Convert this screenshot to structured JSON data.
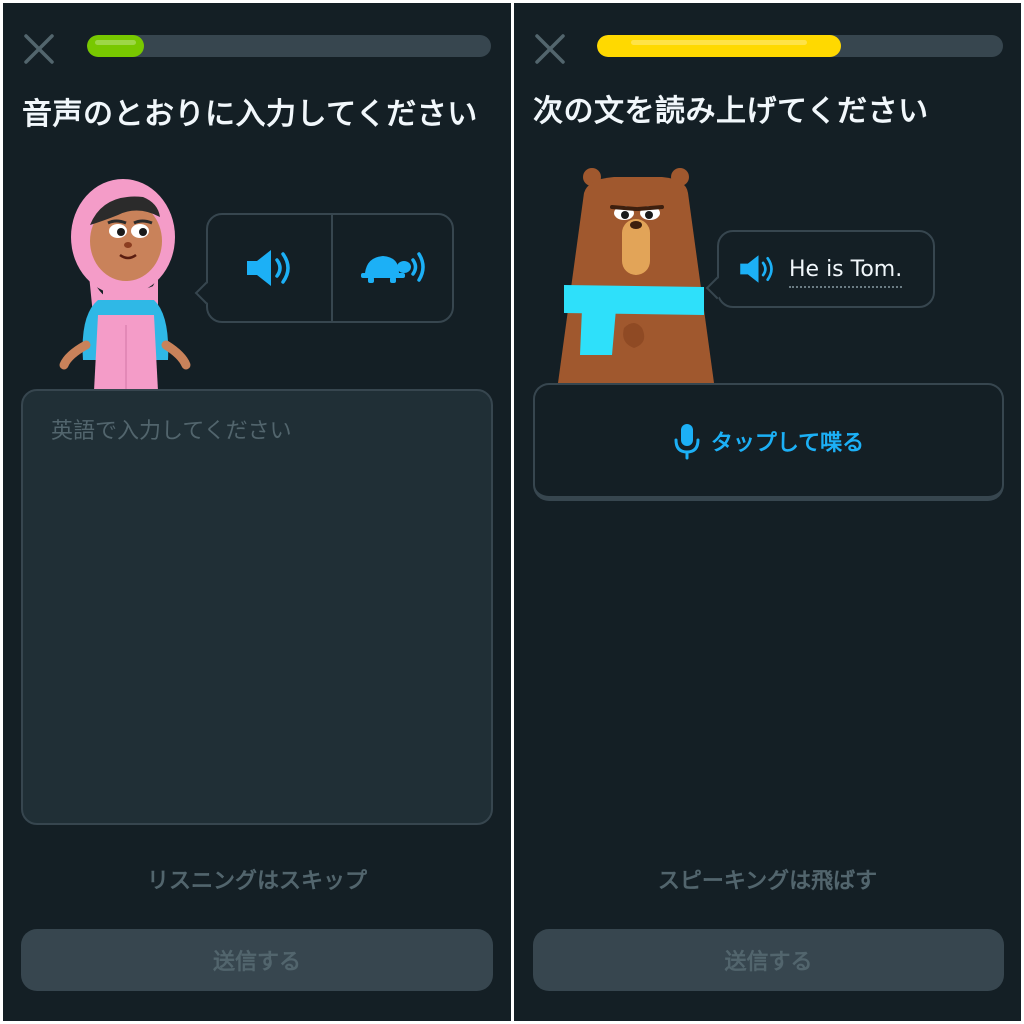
{
  "left": {
    "progress": 0.14,
    "progress_color": "#78c800",
    "heading": "音声のとおりに入力してください",
    "buttons": {
      "normal_speed": "speaker-icon",
      "slow_speed": "turtle-icon"
    },
    "answer_placeholder": "英語で入力してください",
    "skip_label": "リスニングはスキップ",
    "submit_label": "送信する"
  },
  "right": {
    "progress": 0.6,
    "progress_color": "#ffd900",
    "heading": "次の文を読み上げてください",
    "sentence": "He is Tom.",
    "mic_label": "タップして喋る",
    "skip_label": "スピーキングは飛ばす",
    "submit_label": "送信する"
  },
  "colors": {
    "background": "#141f25",
    "accent_blue": "#1cb0f6",
    "border": "#37464f",
    "muted_text": "#52656d"
  }
}
